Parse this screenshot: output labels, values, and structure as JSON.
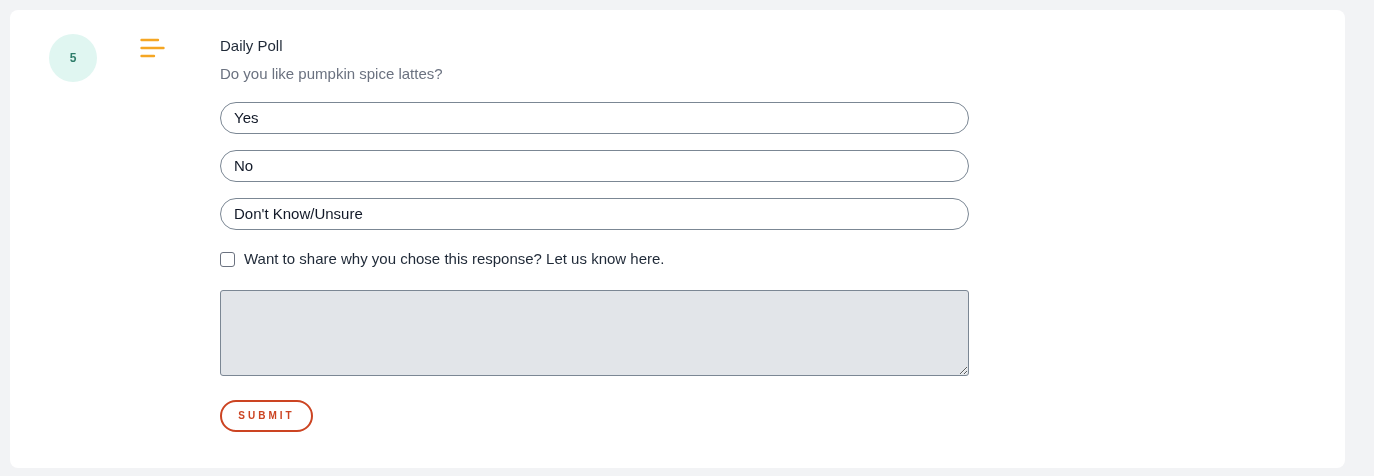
{
  "badge": "5",
  "poll": {
    "title": "Daily Poll",
    "question": "Do you like pumpkin spice lattes?",
    "options": [
      {
        "label": "Yes",
        "selected": false
      },
      {
        "label": "No",
        "selected": false
      },
      {
        "label": "Don't Know/Unsure",
        "selected": false
      }
    ],
    "share": {
      "label": "Want to share why you chose this response? Let us know here.",
      "checked": false
    },
    "comment": {
      "disabled": true
    },
    "submit": "SUBMIT"
  }
}
